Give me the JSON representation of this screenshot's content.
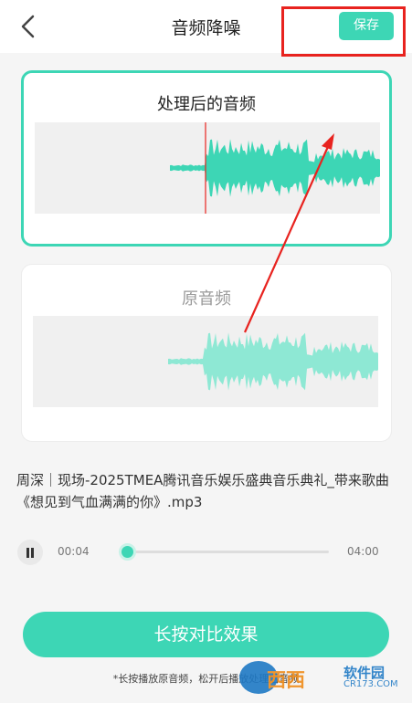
{
  "header": {
    "title": "音频降噪",
    "save_label": "保存"
  },
  "processed": {
    "title": "处理后的音频"
  },
  "original": {
    "title": "原音频"
  },
  "file": {
    "name": "周深｜现场-2025TMEA腾讯音乐娱乐盛典音乐典礼_带来歌曲《想见到气血满满的你》.mp3"
  },
  "player": {
    "current_time": "00:04",
    "total_time": "04:00",
    "progress": 0.0
  },
  "actions": {
    "compare_label": "长按对比效果",
    "hint": "*长按播放原音频，松开后播放处理后音频"
  },
  "watermark": {
    "main": "西西",
    "sub": "软件园",
    "domain": "CR173.COM"
  },
  "colors": {
    "accent": "#3dd6b5",
    "accent_light": "#8ee8d4",
    "annotation": "#e8231f",
    "playhead": "#e8231f"
  },
  "icons": {
    "back": "chevron-left-icon",
    "pause": "pause-icon"
  }
}
